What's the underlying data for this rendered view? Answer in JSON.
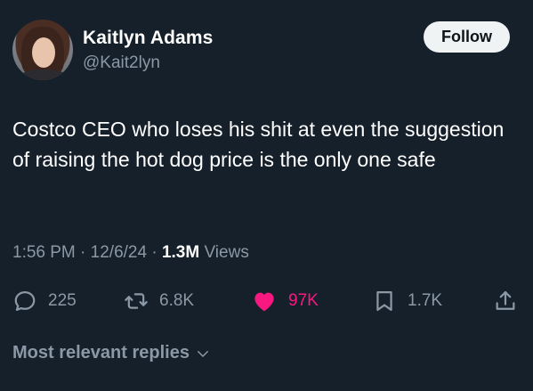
{
  "author": {
    "name": "Kaitlyn Adams",
    "handle": "@Kait2lyn"
  },
  "follow_label": "Follow",
  "tweet": {
    "text": "Costco CEO who loses his shit at even the suggestion of raising the hot dog price is the only one safe"
  },
  "meta": {
    "time": "1:56 PM",
    "sep1": " · ",
    "date": "12/6/24",
    "sep2": " · ",
    "views_count": "1.3M",
    "views_label": " Views"
  },
  "actions": {
    "replies": "225",
    "reposts": "6.8K",
    "likes": "97K",
    "bookmarks": "1.7K"
  },
  "replies_sort_label": "Most relevant replies",
  "colors": {
    "background": "#15202b",
    "muted": "#8b98a5",
    "like": "#f91880",
    "follow_bg": "#eff3f4"
  },
  "icons": [
    "reply-icon",
    "repost-icon",
    "heart-icon",
    "bookmark-icon",
    "share-icon",
    "chevron-down-icon"
  ]
}
